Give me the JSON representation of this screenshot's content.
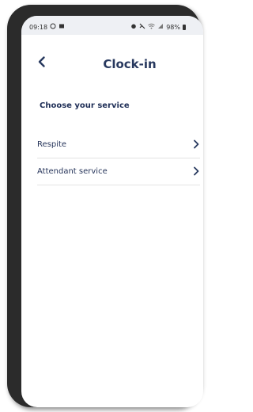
{
  "status_bar": {
    "time": "09:18",
    "battery": "98%"
  },
  "header": {
    "title": "Clock-in",
    "back_icon": "chevron-left-icon"
  },
  "section": {
    "heading": "Choose your service"
  },
  "services": [
    {
      "label": "Respite",
      "icon": "chevron-right-icon"
    },
    {
      "label": "Attendant service",
      "icon": "chevron-right-icon"
    }
  ],
  "colors": {
    "title": "#27385e",
    "text": "#26345a",
    "status_bar_bg": "#eef0f4",
    "divider": "#e3e3e3"
  }
}
